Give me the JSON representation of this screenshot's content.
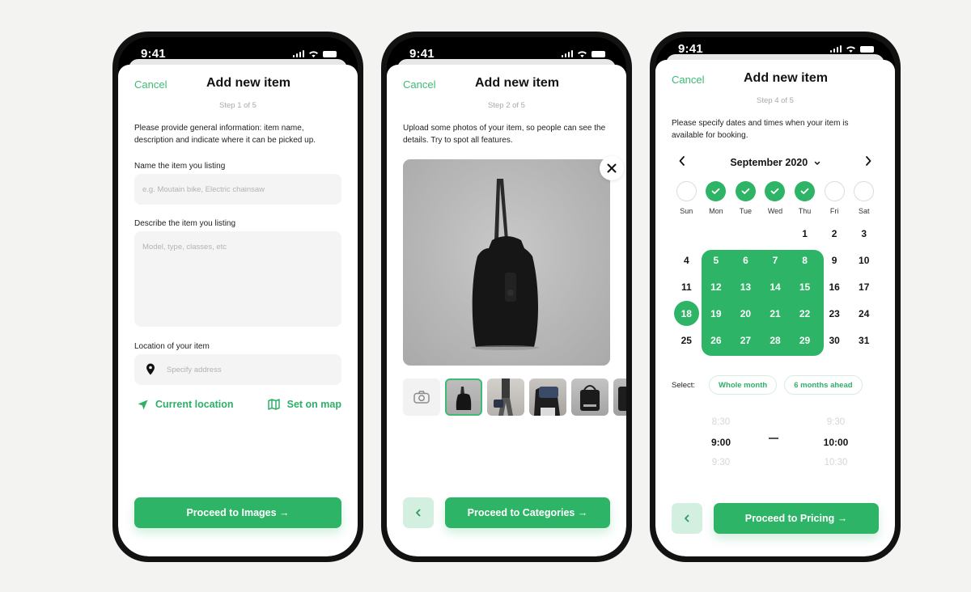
{
  "status_bar": {
    "time": "9:41"
  },
  "colors": {
    "accent": "#2eb466",
    "accent_light": "#d3efe0",
    "cancel": "#3dbb74"
  },
  "screens": [
    {
      "cancel": "Cancel",
      "title": "Add new item",
      "step": "Step 1 of 5",
      "description": "Please provide general information: item name, description and indicate where it can be picked up.",
      "name_field": {
        "label": "Name the item you listing",
        "placeholder": "e.g. Moutain bike, Electric chainsaw",
        "value": ""
      },
      "describe_field": {
        "label": "Describe the item you listing",
        "placeholder": "Model, type, classes, etc",
        "value": ""
      },
      "location_field": {
        "label": "Location of your item",
        "placeholder": "Specify address",
        "icon": "map-pin-icon",
        "value": ""
      },
      "current_location": {
        "label": "Current location",
        "icon": "navigation-arrow-icon"
      },
      "set_on_map": {
        "label": "Set on map",
        "icon": "map-icon"
      },
      "proceed": "Proceed to Images →"
    },
    {
      "cancel": "Cancel",
      "title": "Add new item",
      "step": "Step 2 of 5",
      "description": "Upload some photos of your item, so people can see the details. Try to spot all features.",
      "photo": {
        "alt": "black duffel bag side view",
        "remove_icon": "close-icon"
      },
      "thumbnails": [
        {
          "type": "add-photo",
          "icon": "camera-icon"
        },
        {
          "type": "photo",
          "alt": "black bag side view",
          "selected": true
        },
        {
          "type": "photo",
          "alt": "man walking carrying bag",
          "selected": false
        },
        {
          "type": "photo",
          "alt": "bag on shoulder",
          "selected": false
        },
        {
          "type": "photo",
          "alt": "black bag front view",
          "selected": false
        },
        {
          "type": "photo",
          "alt": "bag partial",
          "selected": false
        }
      ],
      "back_icon": "chevron-left-icon",
      "proceed": "Proceed to Categories →"
    },
    {
      "cancel": "Cancel",
      "title": "Add new item",
      "step": "Step 4 of 5",
      "description": "Please specify dates and times when your item is available for booking.",
      "calendar": {
        "month": "September 2020",
        "weekdays": [
          {
            "label": "Sun",
            "checked": false
          },
          {
            "label": "Mon",
            "checked": true
          },
          {
            "label": "Tue",
            "checked": true
          },
          {
            "label": "Wed",
            "checked": true
          },
          {
            "label": "Thu",
            "checked": true
          },
          {
            "label": "Fri",
            "checked": false
          },
          {
            "label": "Sat",
            "checked": false
          }
        ],
        "first_weekday_index": 2,
        "days_in_month": 30,
        "leading_blank": 4,
        "selected_range_weekdays": [
          "Mon",
          "Tue",
          "Wed",
          "Thu"
        ],
        "selected_range_days": [
          5,
          6,
          7,
          8,
          12,
          13,
          14,
          15,
          19,
          20,
          21,
          22,
          26,
          27,
          28,
          29
        ],
        "single_selected_day": 18
      },
      "select": {
        "label": "Select:",
        "chips": [
          "Whole month",
          "6 months ahead"
        ]
      },
      "time_from": {
        "prev": "8:30",
        "current": "9:00",
        "next": "9:30"
      },
      "time_to": {
        "prev": "9:30",
        "current": "10:00",
        "next": "10:30"
      },
      "back_icon": "chevron-left-icon",
      "proceed": "Proceed to Pricing →"
    }
  ]
}
